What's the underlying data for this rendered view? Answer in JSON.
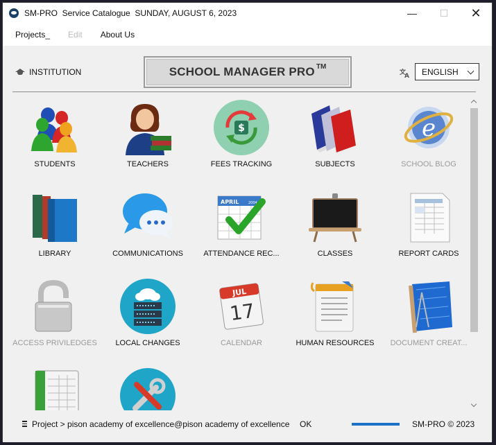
{
  "window": {
    "title": "SM-PRO  Service Catalogue  SUNDAY, AUGUST 6, 2023",
    "controls": {
      "minimize": "—",
      "maximize": "☐",
      "close": "✕"
    }
  },
  "menu": [
    {
      "label": "Projects_",
      "enabled": true
    },
    {
      "label": "Edit",
      "enabled": false
    },
    {
      "label": "About Us",
      "enabled": true
    }
  ],
  "header": {
    "institution_label": "INSTITUTION",
    "brand": "SCHOOL MANAGER PRO",
    "brand_mark": "TM",
    "language": {
      "selected": "ENGLISH",
      "icon": "translate-icon"
    }
  },
  "tiles": [
    {
      "label": "STUDENTS",
      "icon": "students-icon",
      "enabled": true
    },
    {
      "label": "TEACHERS",
      "icon": "teacher-icon",
      "enabled": true
    },
    {
      "label": "FEES TRACKING",
      "icon": "fees-icon",
      "enabled": true
    },
    {
      "label": "SUBJECTS",
      "icon": "books-icon",
      "enabled": true
    },
    {
      "label": "SCHOOL BLOG",
      "icon": "ie-icon",
      "enabled": false
    },
    {
      "label": "LIBRARY",
      "icon": "library-icon",
      "enabled": true
    },
    {
      "label": "COMMUNICATIONS",
      "icon": "chat-icon",
      "enabled": true
    },
    {
      "label": "ATTENDANCE REC...",
      "icon": "attendance-icon",
      "enabled": true
    },
    {
      "label": "CLASSES",
      "icon": "blackboard-icon",
      "enabled": true
    },
    {
      "label": "REPORT CARDS",
      "icon": "report-icon",
      "enabled": true
    },
    {
      "label": "ACCESS PRIVILEDGES",
      "icon": "padlock-icon",
      "enabled": false
    },
    {
      "label": "LOCAL CHANGES",
      "icon": "server-icon",
      "enabled": true
    },
    {
      "label": "CALENDAR",
      "icon": "calendar-icon",
      "enabled": false
    },
    {
      "label": "HUMAN RESOURCES",
      "icon": "clipboard-icon",
      "enabled": true
    },
    {
      "label": "DOCUMENT CREAT...",
      "icon": "blueprint-icon",
      "enabled": false
    },
    {
      "label": "",
      "icon": "ledger-icon",
      "enabled": true
    },
    {
      "label": "",
      "icon": "tools-icon",
      "enabled": true
    }
  ],
  "icon_text": {
    "calendar_month": "JUL",
    "calendar_day": "17",
    "attendance_month": "APRIL",
    "attendance_year": "2004"
  },
  "status": {
    "path": "Project > pison academy of excellence@pison academy of excellence",
    "state": "OK",
    "progress": 1.0,
    "copyright": "SM-PRO © 2023"
  },
  "colors": {
    "accent": "#1a73c9",
    "background": "#f0f0f0",
    "disabled_text": "#9a9a9a"
  }
}
